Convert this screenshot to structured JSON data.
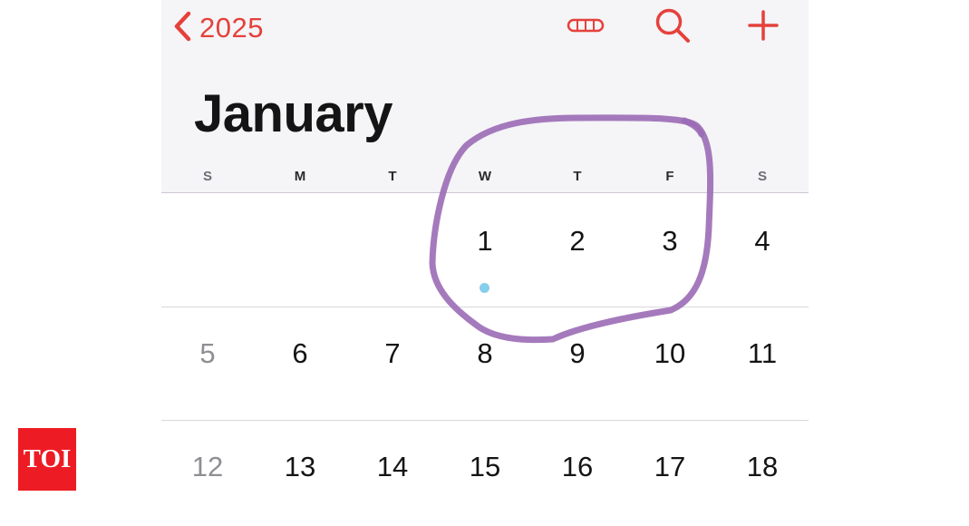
{
  "nav": {
    "back_label": "2025"
  },
  "header": {
    "month": "January"
  },
  "weekdays": [
    "S",
    "M",
    "T",
    "W",
    "T",
    "F",
    "S"
  ],
  "weeks": [
    [
      "",
      "",
      "",
      "1",
      "2",
      "3",
      "4"
    ],
    [
      "5",
      "6",
      "7",
      "8",
      "9",
      "10",
      "11"
    ],
    [
      "12",
      "13",
      "14",
      "15",
      "16",
      "17",
      "18"
    ]
  ],
  "events": [
    "2025-01-01"
  ],
  "icons": {
    "back": "chevron-left-icon",
    "view_toggle": "list-view-icon",
    "search": "search-icon",
    "add": "plus-icon"
  },
  "watermark": {
    "text": "TOI"
  },
  "colors": {
    "accent": "#e5413b",
    "event_dot": "#87cdec",
    "annotation": "#9b6bb5",
    "watermark_bg": "#ed1c24"
  }
}
